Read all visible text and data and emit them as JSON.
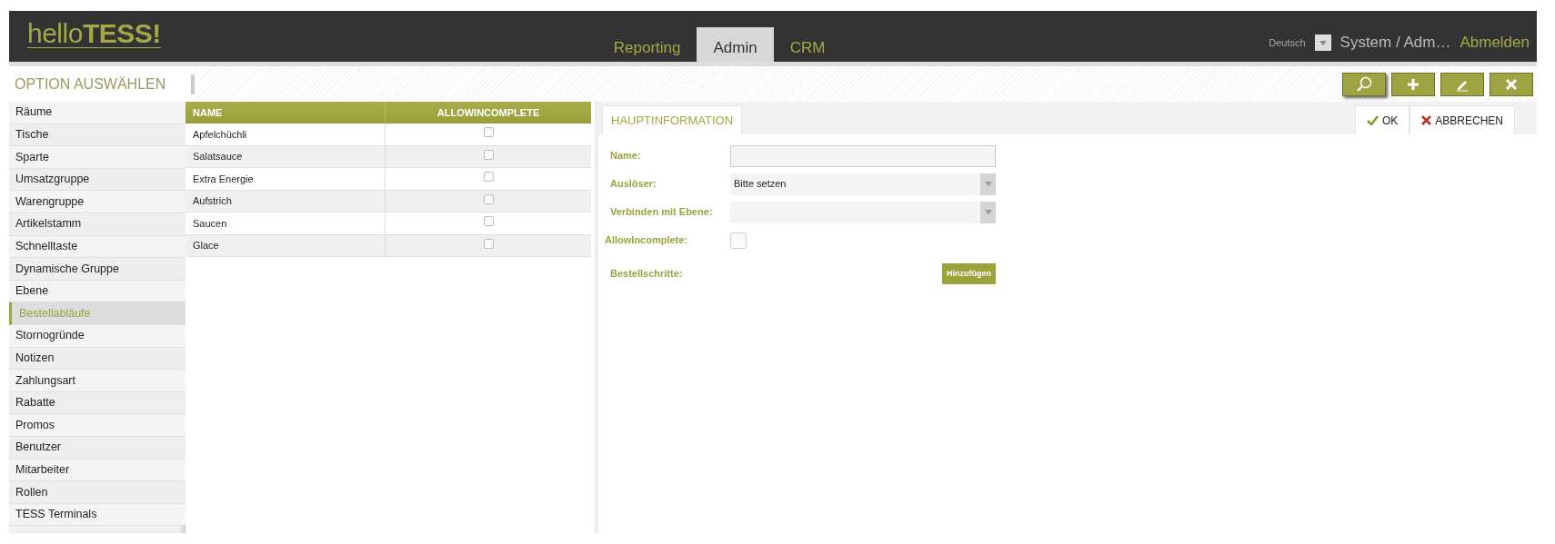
{
  "logo": "hello**TESS!**",
  "nav_tabs": [
    {
      "label": "Reporting",
      "selected": false
    },
    {
      "label": "Admin",
      "selected": true
    },
    {
      "label": "CRM",
      "selected": false
    }
  ],
  "language": "Deutsch",
  "user": "System / Adm…",
  "logout": "Abmelden",
  "toolbar": {
    "title": "OPTION AUSWÄHLEN",
    "buttons": [
      {
        "kind": "search",
        "selected": true
      },
      {
        "kind": "add",
        "selected": false
      },
      {
        "kind": "edit",
        "selected": false
      },
      {
        "kind": "delete",
        "selected": false
      }
    ]
  },
  "sidebar": {
    "items": [
      {
        "label": "Räume",
        "selected": false
      },
      {
        "label": "Tische",
        "selected": false
      },
      {
        "label": "Sparte",
        "selected": false
      },
      {
        "label": "Umsatzgruppe",
        "selected": false
      },
      {
        "label": "Warengruppe",
        "selected": false
      },
      {
        "label": "Artikelstamm",
        "selected": false
      },
      {
        "label": "Schnelltaste",
        "selected": false
      },
      {
        "label": "Dynamische Gruppe",
        "selected": false
      },
      {
        "label": "Ebene",
        "selected": false
      },
      {
        "label": "Bestellabläufe",
        "selected": true
      },
      {
        "label": "Stornogründe",
        "selected": false
      },
      {
        "label": "Notizen",
        "selected": false
      },
      {
        "label": "Zahlungsart",
        "selected": false
      },
      {
        "label": "Rabatte",
        "selected": false
      },
      {
        "label": "Promos",
        "selected": false
      },
      {
        "label": "Benutzer",
        "selected": false
      },
      {
        "label": "Mitarbeiter",
        "selected": false
      },
      {
        "label": "Rollen",
        "selected": false
      },
      {
        "label": "TESS Terminals",
        "selected": false
      }
    ]
  },
  "table": {
    "columns": [
      "NAME",
      "ALLOWINCOMPLETE"
    ],
    "rows": [
      {
        "name": "Apfelchüchli",
        "allow_incomplete": false
      },
      {
        "name": "Salatsauce",
        "allow_incomplete": false
      },
      {
        "name": "Extra Energie",
        "allow_incomplete": false
      },
      {
        "name": "Aufstrich",
        "allow_incomplete": false
      },
      {
        "name": "Saucen",
        "allow_incomplete": false
      },
      {
        "name": "Glace",
        "allow_incomplete": false
      }
    ]
  },
  "detail": {
    "tab": {
      "label": "HAUPTINFORMATION",
      "selected": true
    },
    "ok": "OK",
    "cancel": "ABBRECHEN",
    "fields": [
      {
        "kind": "text",
        "label": "Name:"
      },
      {
        "kind": "select",
        "label": "Auslöser:",
        "value": "Bitte setzen"
      },
      {
        "kind": "select",
        "label": "Verbinden mit Ebene:"
      },
      {
        "kind": "checkbox",
        "label": "AllowIncomplete:",
        "checked": false
      },
      {
        "kind": "button",
        "label": "Bestellschritte:",
        "button": "Hinzufügen"
      }
    ]
  }
}
